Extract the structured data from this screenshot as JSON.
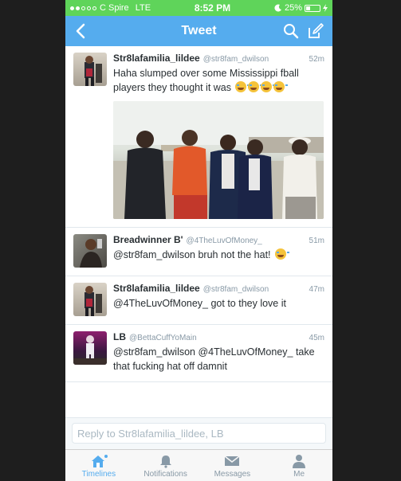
{
  "status_bar": {
    "carrier": "C Spire",
    "network": "LTE",
    "time": "8:52 PM",
    "battery": "25%",
    "battery_level": 0.25
  },
  "nav": {
    "title": "Tweet"
  },
  "tweets": [
    {
      "name": "Str8lafamilia_lildee",
      "handle": "@str8fam_dwilson",
      "time": "52m",
      "text": "Haha slumped over some Mississippi fball players they thought it was"
    },
    {
      "name": "Breadwinner B'",
      "handle": "@4TheLuvOfMoney_",
      "time": "51m",
      "text": "@str8fam_dwilson bruh not the hat!"
    },
    {
      "name": "Str8lafamilia_lildee",
      "handle": "@str8fam_dwilson",
      "time": "47m",
      "text": "@4TheLuvOfMoney_ got to they love it"
    },
    {
      "name": "LB",
      "handle": "@BettaCuffYoMain",
      "time": "45m",
      "text": "@str8fam_dwilson @4TheLuvOfMoney_ take that fucking hat off damnit"
    }
  ],
  "reply": {
    "placeholder": "Reply to Str8lafamilia_lildee, LB"
  },
  "tabs": [
    {
      "label": "Timelines",
      "icon": "home-icon",
      "active": true
    },
    {
      "label": "Notifications",
      "icon": "bell-icon",
      "active": false
    },
    {
      "label": "Messages",
      "icon": "envelope-icon",
      "active": false
    },
    {
      "label": "Me",
      "icon": "person-icon",
      "active": false
    }
  ],
  "colors": {
    "status_bar": "#5fd45a",
    "nav_bar": "#55acee",
    "active_tab": "#55acee"
  }
}
